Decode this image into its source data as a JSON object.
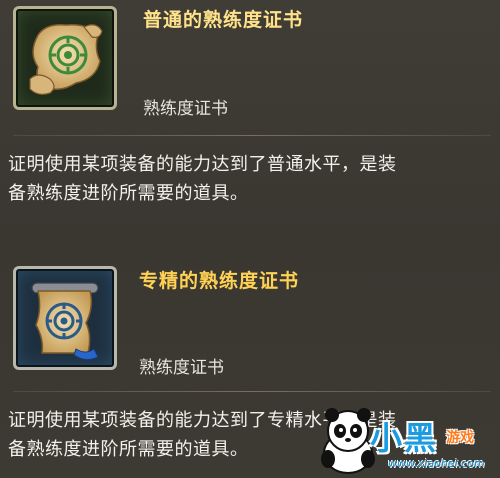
{
  "items": [
    {
      "title": "普通的熟练度证书",
      "category": "熟练度证书",
      "description_lines": [
        "证明使用某项装备的能力达到了普通水平，是装",
        "备熟练度进阶所需要的道具。"
      ],
      "icon": "green-scroll-icon",
      "title_color": "#ffe28a",
      "frame_color": "#1f2a1b"
    },
    {
      "title": "专精的熟练度证书",
      "category": "熟练度证书",
      "description_lines": [
        "证明使用某项装备的能力达到了专精水平，是装",
        "备熟练度进阶所需要的道具。"
      ],
      "icon": "blue-scroll-icon",
      "title_color": "#ffd255",
      "frame_color": "#1e3040"
    }
  ],
  "watermark": {
    "brand": "小黑",
    "sub": "游戏",
    "url": "www.xiaohei.com",
    "icon": "panda-logo-icon"
  }
}
